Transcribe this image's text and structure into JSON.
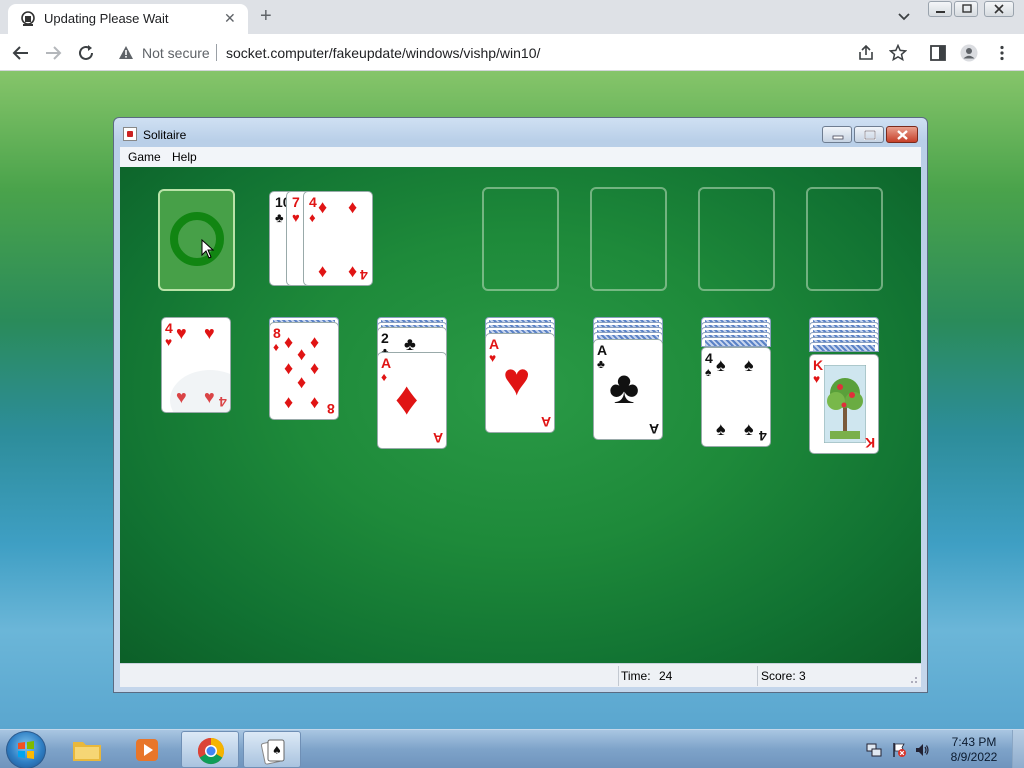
{
  "browser": {
    "tab_title": "Updating Please Wait",
    "security_label": "Not secure",
    "url": "socket.computer/fakeupdate/windows/vishp/win10/"
  },
  "window": {
    "title": "Solitaire",
    "menu": [
      "Game",
      "Help"
    ]
  },
  "status": {
    "time_label": "Time:",
    "time_value": "24",
    "score_label": "Score: 3"
  },
  "cards": {
    "waste": [
      "10",
      "7",
      "4"
    ],
    "waste_suits": [
      "♣",
      "♥",
      "♦"
    ],
    "tableau": [
      {
        "rank": "4",
        "suit": "♥"
      },
      {
        "rank": "8",
        "suit": "♦"
      },
      {
        "rank": "A",
        "suit": "♦",
        "under_rank": "2",
        "under_suit": "♣"
      },
      {
        "rank": "A",
        "suit": "♥"
      },
      {
        "rank": "A",
        "suit": "♣"
      },
      {
        "rank": "4",
        "suit": "♠"
      },
      {
        "rank": "K",
        "suit": "♥"
      }
    ]
  },
  "taskbar": {
    "time": "7:43 PM",
    "date": "8/9/2022"
  },
  "colors": {
    "felt": "#1e8a3a",
    "red_suit": "#e01414"
  }
}
